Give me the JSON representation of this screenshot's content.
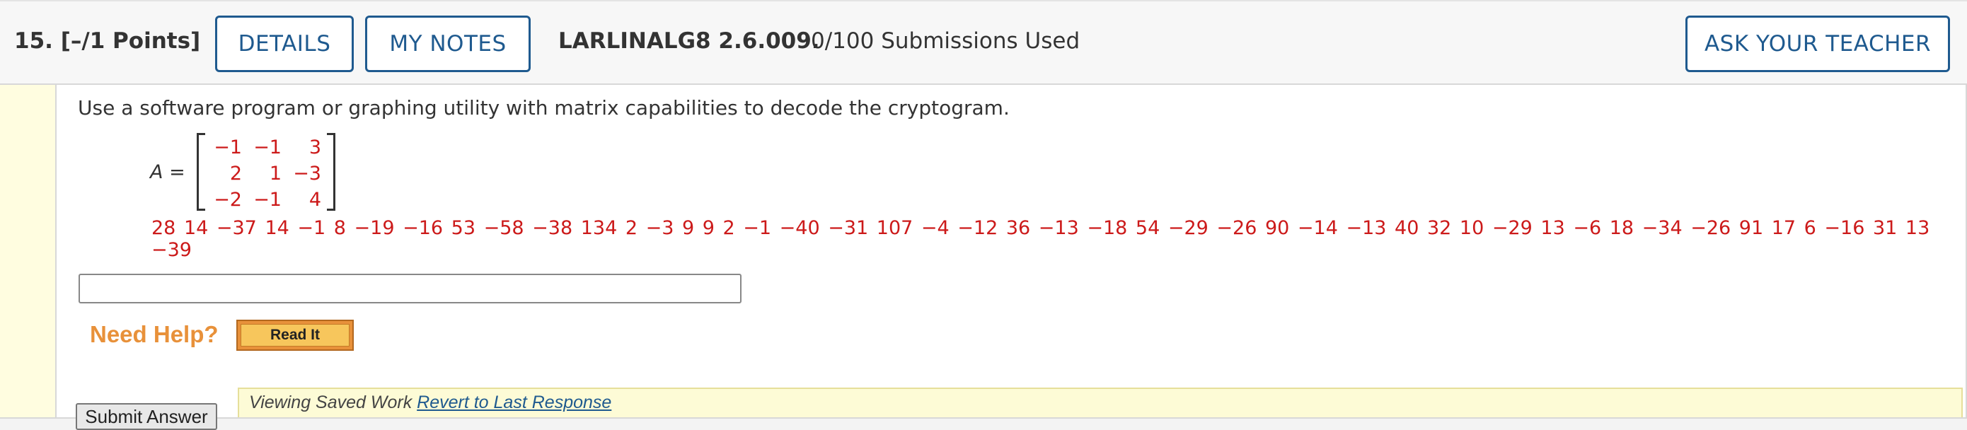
{
  "header": {
    "question_label": "15.  [–/1 Points]",
    "details_label": "DETAILS",
    "my_notes_label": "MY NOTES",
    "problem_id": "LARLINALG8 2.6.009.",
    "submissions": "0/100 Submissions Used",
    "ask_teacher_label": "ASK YOUR TEACHER"
  },
  "problem": {
    "prompt": "Use a software program or graphing utility with matrix capabilities to decode the cryptogram.",
    "matrix_name": "A",
    "matrix_equals": " =",
    "matrix": [
      [
        "−1",
        "−1",
        "3"
      ],
      [
        "2",
        "1",
        "−3"
      ],
      [
        "−2",
        "−1",
        "4"
      ]
    ],
    "cryptogram": "28  14  −37  14  −1  8  −19  −16  53  −58  −38  134  2  −3  9  9  2  −1  −40  −31  107  −4  −12  36  −13  −18  54  −29  −26  90  −14  −13  40  32  10  −29  13  −6  18  −34  −26  91  17  6  −16  31  13  −39"
  },
  "answer": {
    "value": "",
    "placeholder": ""
  },
  "help": {
    "need_help_label": "Need Help?",
    "read_it_label": "Read It"
  },
  "saved": {
    "viewing_text": "Viewing Saved Work ",
    "revert_link": "Revert to Last Response"
  },
  "submit_label": "Submit Answer",
  "colors": {
    "accent_blue": "#1f5a8f",
    "math_red": "#cc1a1a",
    "help_orange": "#e8913a",
    "saved_bg": "#fdfbd6"
  }
}
